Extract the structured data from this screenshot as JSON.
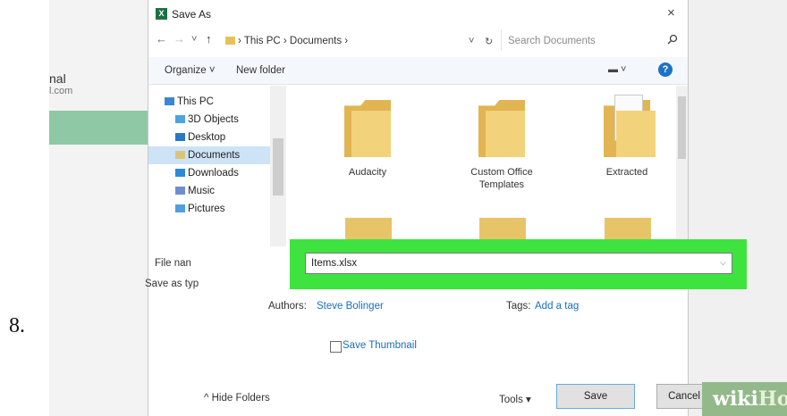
{
  "step_number": "8.",
  "background_app": {
    "name_fragment": "nal",
    "email_fragment": "l.com"
  },
  "dialog": {
    "title": "Save As",
    "app_icon": "excel-icon",
    "close_glyph": "×",
    "address": {
      "back_glyph": "←",
      "forward_glyph": "→",
      "dropdown_glyph": "˅",
      "up_glyph": "↑",
      "path": "› This PC › Documents ›",
      "dropdown2_glyph": "˅",
      "refresh_glyph": "↻",
      "search_placeholder": "Search Documents",
      "search_icon": "search-icon"
    },
    "commands": {
      "organize": "Organize ˅",
      "new_folder": "New folder",
      "view_glyph": "▬ ˅",
      "help_glyph": "?"
    },
    "nav_pane": {
      "items": [
        {
          "label": "This PC",
          "icon": "pc-icon",
          "color": "#3b87d4"
        },
        {
          "label": "3D Objects",
          "icon": "cube-icon",
          "color": "#4fa2e3"
        },
        {
          "label": "Desktop",
          "icon": "desktop-icon",
          "color": "#2a77c9"
        },
        {
          "label": "Documents",
          "icon": "documents-icon",
          "color": "#d9c47d",
          "selected": true
        },
        {
          "label": "Downloads",
          "icon": "download-icon",
          "color": "#2a8ad8"
        },
        {
          "label": "Music",
          "icon": "music-icon",
          "color": "#6e8fcf"
        },
        {
          "label": "Pictures",
          "icon": "pictures-icon",
          "color": "#4fa0dc"
        }
      ]
    },
    "files": [
      {
        "name_line1": "Audacity",
        "name_line2": "",
        "icon": "folder-icon"
      },
      {
        "name_line1": "Custom Office",
        "name_line2": "Templates",
        "icon": "folder-icon"
      },
      {
        "name_line1": "Extracted",
        "name_line2": "",
        "icon": "folder-with-documents-icon"
      }
    ],
    "form": {
      "file_name_label": "File nan",
      "file_name_value": "Items.xlsx",
      "save_as_type_label": "Save as typ",
      "authors_label": "Authors:",
      "authors_value": "Steve Bolinger",
      "tags_label": "Tags:",
      "tags_value": "Add a tag",
      "save_thumbnail_label": "Save Thumbnail",
      "save_thumbnail_checked": false
    },
    "footer": {
      "hide_folders": "^ Hide Folders",
      "tools": "Tools ▾",
      "save": "Save",
      "cancel": "Cancel"
    }
  },
  "highlight_color": "#3fe33f",
  "watermark": {
    "part1": "wiki",
    "part2": "How"
  }
}
